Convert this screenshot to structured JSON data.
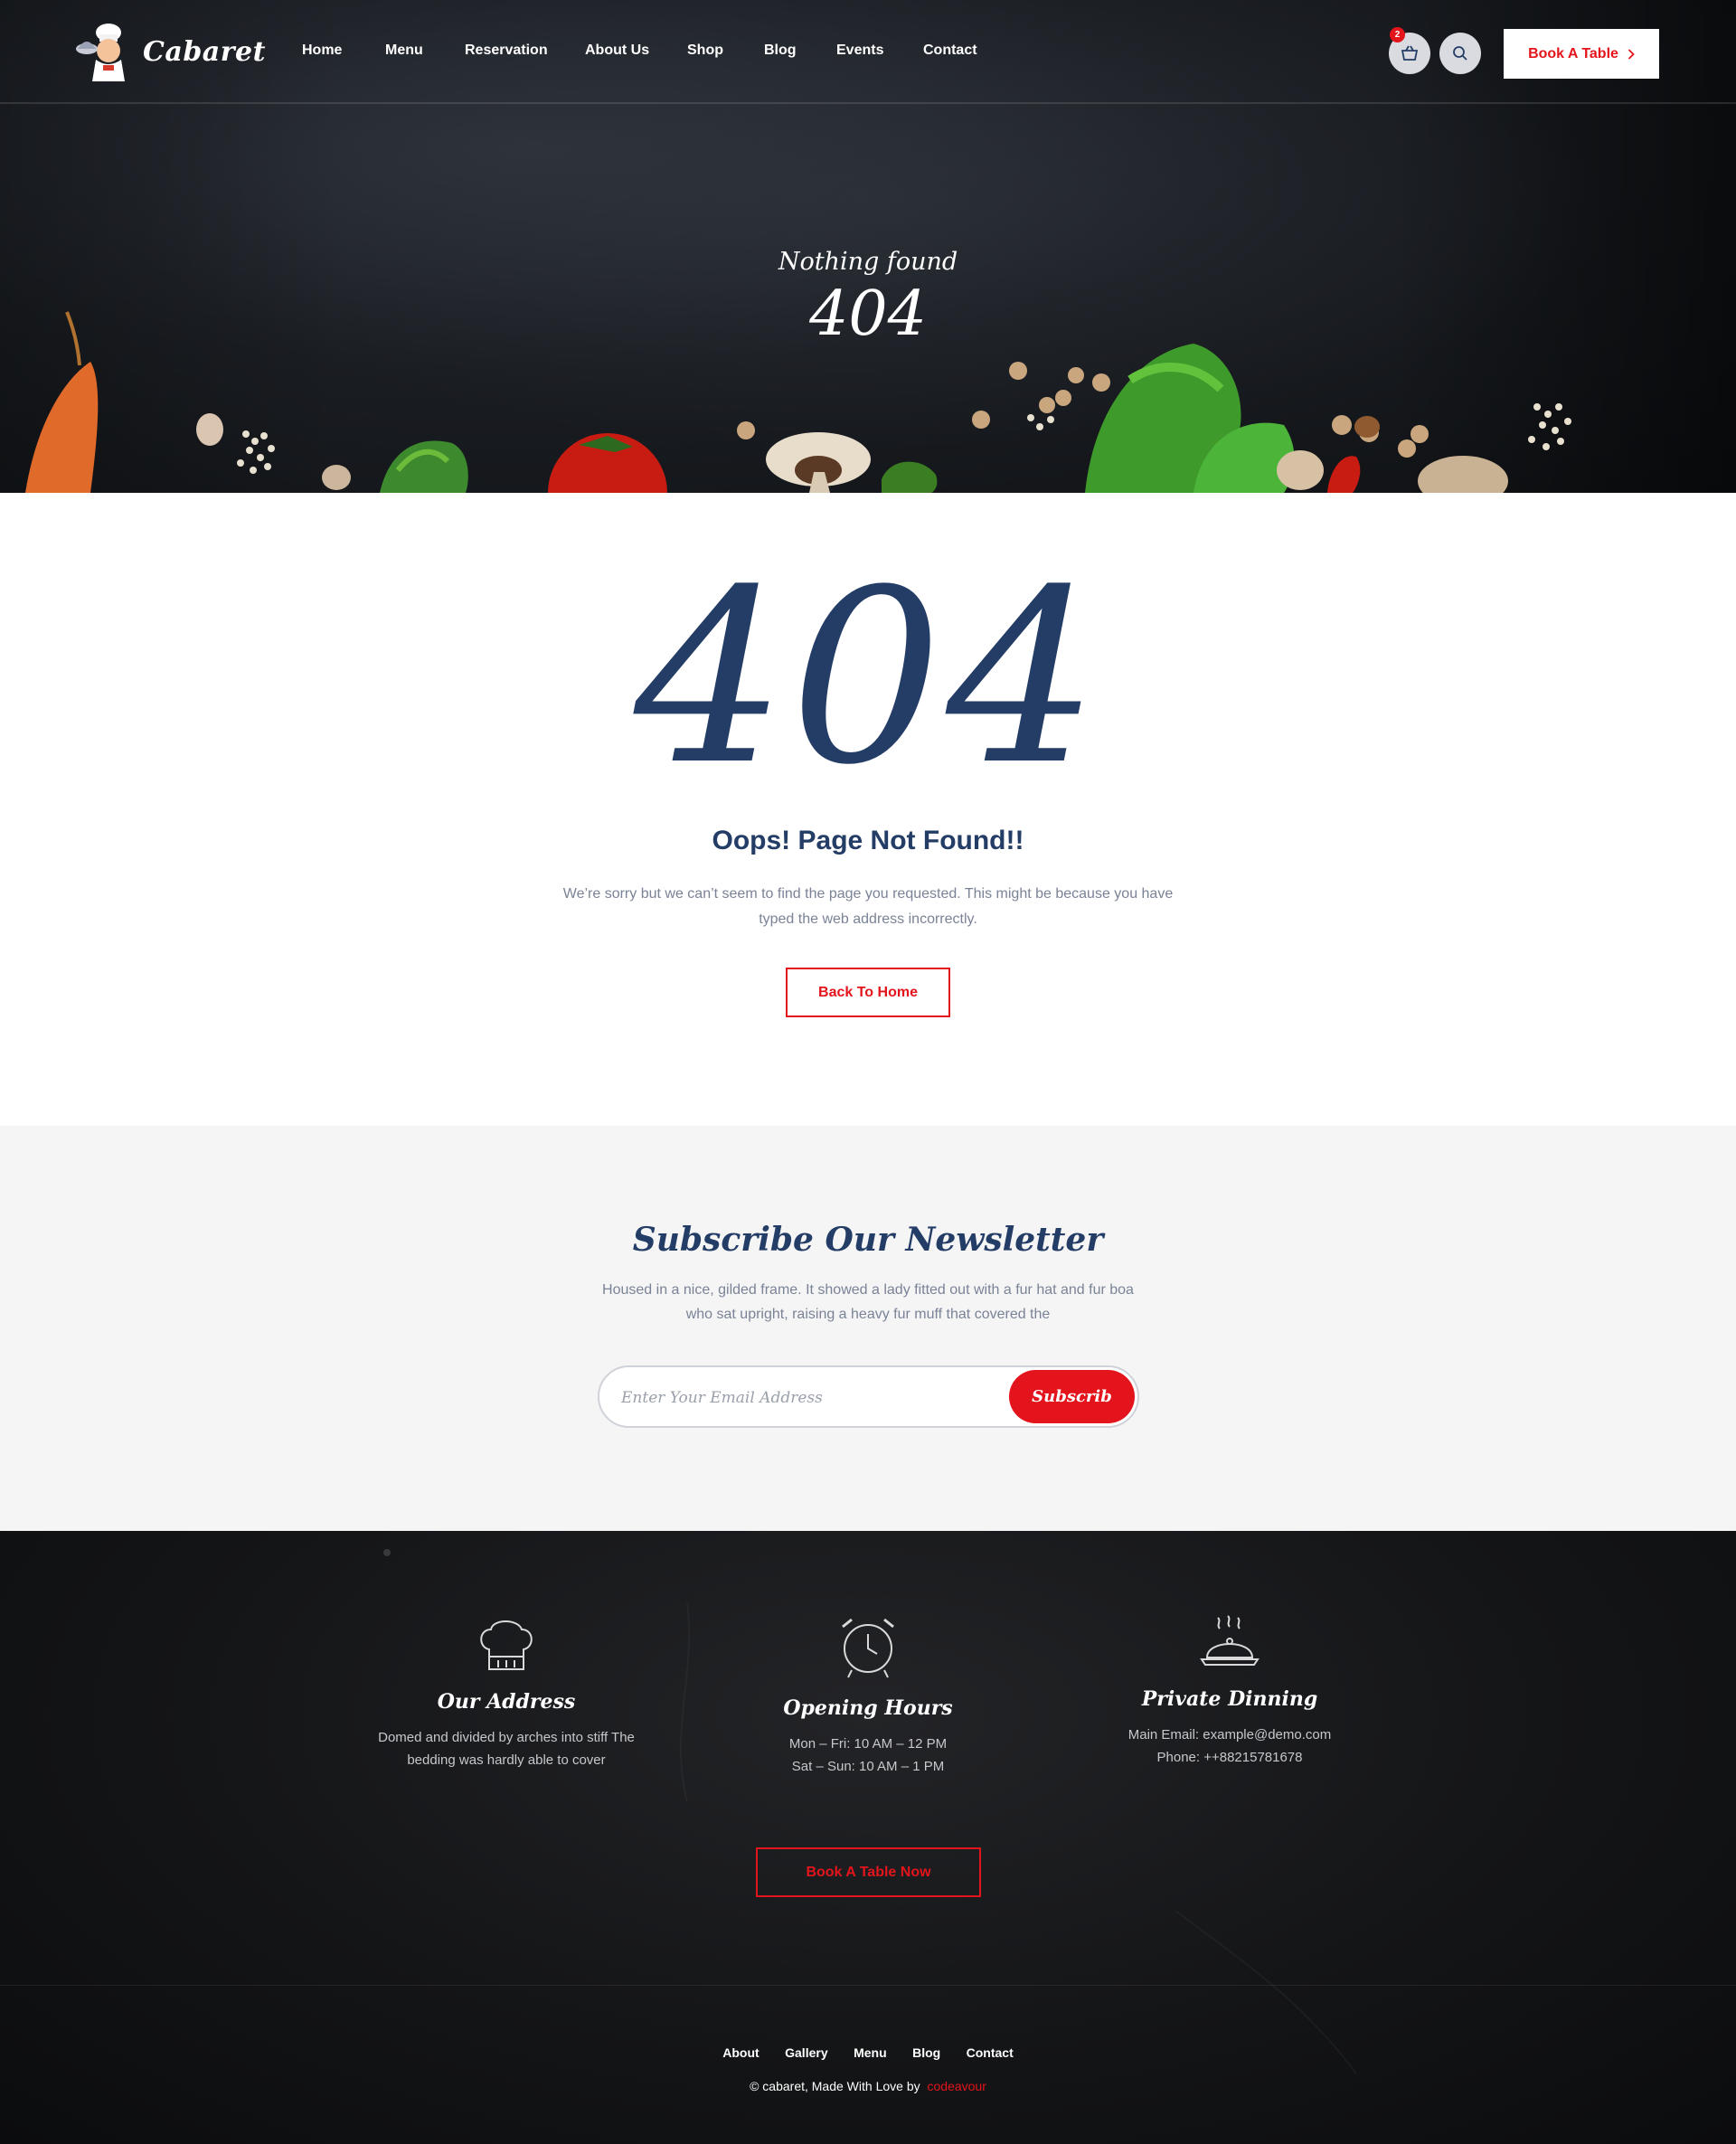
{
  "header": {
    "brand": "Cabaret",
    "nav": [
      "Home",
      "Menu",
      "Reservation",
      "About Us",
      "Shop",
      "Blog",
      "Events",
      "Contact"
    ],
    "cart_count": "2",
    "book_button": "Book A Table",
    "icons": {
      "cart": "basket-icon",
      "search": "search-icon",
      "arrow": "chevron-right-icon"
    }
  },
  "hero": {
    "subtitle": "Nothing found",
    "code": "404"
  },
  "error": {
    "code": "404",
    "title": "Oops! Page Not Found!!",
    "message": "We’re sorry but we can’t seem to find the page you requested. This might be because you have typed the web address incorrectly.",
    "button": "Back To Home"
  },
  "newsletter": {
    "title": "Subscribe Our Newsletter",
    "description": "Housed in a nice, gilded frame. It showed a lady fitted out with a fur hat and fur boa who sat upright, raising a heavy fur muff that covered the",
    "placeholder": "Enter Your Email Address",
    "button": "Subscrib"
  },
  "footer": {
    "columns": [
      {
        "icon": "chef-hat-icon",
        "title": "Our Address",
        "lines": [
          "Domed and divided by arches into stiff The",
          "bedding was hardly able to cover"
        ]
      },
      {
        "icon": "alarm-clock-icon",
        "title": "Opening Hours",
        "lines": [
          "Mon – Fri: 10 AM – 12 PM",
          "Sat – Sun: 10 AM – 1 PM"
        ]
      },
      {
        "icon": "food-cloche-icon",
        "title": "Private Dinning",
        "lines": [
          "Main Email: example@demo.com",
          "Phone: ++88215781678"
        ]
      }
    ],
    "book_button": "Book A Table Now",
    "links": [
      "About",
      "Gallery",
      "Menu",
      "Blog",
      "Contact"
    ],
    "copyright": "© cabaret, Made With Love by",
    "credit": "codeavour"
  },
  "colors": {
    "accent": "#e3141b",
    "navy": "#243d66",
    "muted": "#7a8396",
    "dark": "#141517"
  }
}
